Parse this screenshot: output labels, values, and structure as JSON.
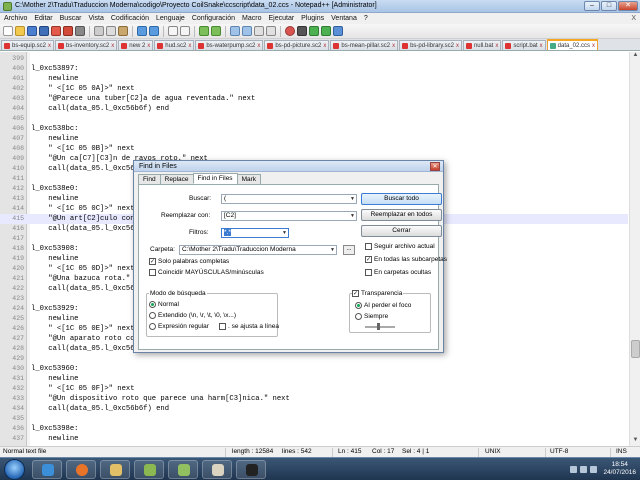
{
  "window": {
    "title": "C:\\Mother 2\\Tradu\\Traduccion Moderna\\codigo\\Proyecto CoilSnake\\ccscript\\data_02.ccs - Notepad++ [Administrator]",
    "min": "‒",
    "max": "□",
    "close": "✕"
  },
  "menu": [
    "Archivo",
    "Editar",
    "Buscar",
    "Vista",
    "Codificación",
    "Lenguaje",
    "Configuración",
    "Macro",
    "Ejecutar",
    "Plugins",
    "Ventana",
    "?"
  ],
  "menu_close": "X",
  "tabs": [
    {
      "label": "bs-equip.sc2"
    },
    {
      "label": "bs-inventory.sc2"
    },
    {
      "label": "new 2"
    },
    {
      "label": "hud.sc2"
    },
    {
      "label": "bs-waterpump.sc2"
    },
    {
      "label": "bs-pd-picture.sc2"
    },
    {
      "label": "bs-mean-pillar.sc2"
    },
    {
      "label": "bs-pd-library.sc2"
    },
    {
      "label": "null.bat"
    },
    {
      "label": "script.bat"
    },
    {
      "label": "data_02.ccs"
    }
  ],
  "tab_close": "x",
  "lines": [
    {
      "n": "399",
      "t": ""
    },
    {
      "n": "400",
      "t": "l_0xc53897:"
    },
    {
      "n": "401",
      "t": "    newline"
    },
    {
      "n": "402",
      "t": "    \" <[1C 05 0A]>\" next"
    },
    {
      "n": "403",
      "t": "    \"@Parece una tuber[C2]a de agua reventada.\" next"
    },
    {
      "n": "404",
      "t": "    call(data_05.l_0xc56b6f) end"
    },
    {
      "n": "405",
      "t": ""
    },
    {
      "n": "406",
      "t": "l_0xc538bc:"
    },
    {
      "n": "407",
      "t": "    newline"
    },
    {
      "n": "408",
      "t": "    \" <[1C 05 0B]>\" next"
    },
    {
      "n": "409",
      "t": "    \"@Un ca[C7][C3]n de rayos roto.\" next"
    },
    {
      "n": "410",
      "t": "    call(data_05.l_0xc56"
    },
    {
      "n": "411",
      "t": ""
    },
    {
      "n": "412",
      "t": "l_0xc538e0:"
    },
    {
      "n": "413",
      "t": "    newline"
    },
    {
      "n": "414",
      "t": "    \" <[1C 05 0C]>\" next"
    },
    {
      "n": "415",
      "t": "    \"@Un art[C2]culo con"
    },
    {
      "n": "416",
      "t": "    call(data_05.l_0xc56"
    },
    {
      "n": "417",
      "t": ""
    },
    {
      "n": "418",
      "t": "l_0xc53908:"
    },
    {
      "n": "419",
      "t": "    newline"
    },
    {
      "n": "420",
      "t": "    \" <[1C 05 0D]>\" next"
    },
    {
      "n": "421",
      "t": "    \"@Una bazuca rota.\""
    },
    {
      "n": "422",
      "t": "    call(data_05.l_0xc56"
    },
    {
      "n": "423",
      "t": ""
    },
    {
      "n": "424",
      "t": "l_0xc53929:"
    },
    {
      "n": "425",
      "t": "    newline"
    },
    {
      "n": "426",
      "t": "    \" <[1C 05 0E]>\" next"
    },
    {
      "n": "427",
      "t": "    \"@Un aparato roto co"
    },
    {
      "n": "428",
      "t": "    call(data_05.l_0xc56"
    },
    {
      "n": "429",
      "t": ""
    },
    {
      "n": "430",
      "t": "l_0xc53960:"
    },
    {
      "n": "431",
      "t": "    newline"
    },
    {
      "n": "432",
      "t": "    \" <[1C 05 0F]>\" next"
    },
    {
      "n": "433",
      "t": "    \"@Un dispositivo roto que parece una harm[C3]nica.\" next"
    },
    {
      "n": "434",
      "t": "    call(data_05.l_0xc56b6f) end"
    },
    {
      "n": "435",
      "t": ""
    },
    {
      "n": "436",
      "t": "l_0xc5398e:"
    },
    {
      "n": "437",
      "t": "    newline"
    }
  ],
  "dialog": {
    "title": "Find in Files",
    "close": "✕",
    "tabs": [
      "Find",
      "Replace",
      "Find in Files",
      "Mark"
    ],
    "find_label": "Buscar:",
    "find_value": "(",
    "replace_label": "Reemplazar con:",
    "replace_value": "[C2]",
    "filters_label": "Filtros:",
    "filters_value": "*.*",
    "folder_label": "Carpeta:",
    "folder_value": "C:\\Mother 2\\Tradu\\Traduccion Moderna",
    "browse": "...",
    "btn_find_all": "Buscar todo",
    "btn_replace_all": "Reemplazar en todos",
    "btn_close": "Cerrar",
    "follow_doc": "Seguir archivo actual",
    "subfolders": "En todas las subcarpetas",
    "hidden": "En carpetas ocultas",
    "whole_word": "Solo palabras completas",
    "match_case": "Coincidir MAYÚSCULAS/minúsculas",
    "search_mode_title": "Modo de búsqueda",
    "mode_normal": "Normal",
    "mode_extended": "Extendido (\\n, \\r, \\t, \\0, \\x...)",
    "mode_regex": "Expresión regular",
    "dot_newline": ". se ajusta a línea",
    "transparency": "Transparencia",
    "on_lose_focus": "Al perder el foco",
    "always": "Siempre",
    "check": "✓"
  },
  "status": {
    "type": "Normal text file",
    "length": "length : 12584",
    "lines": "lines : 542",
    "pos": "Ln : 415",
    "col": "Col : 17",
    "sel": "Sel : 4 | 1",
    "eol": "UNIX",
    "enc": "UTF-8",
    "ins": "INS"
  },
  "clock": {
    "time": "18:54",
    "date": "24/07/2016"
  },
  "colors": {
    "accent": "#f5a623",
    "keyword": "#8000ff",
    "selection": "#e8e8ff"
  }
}
